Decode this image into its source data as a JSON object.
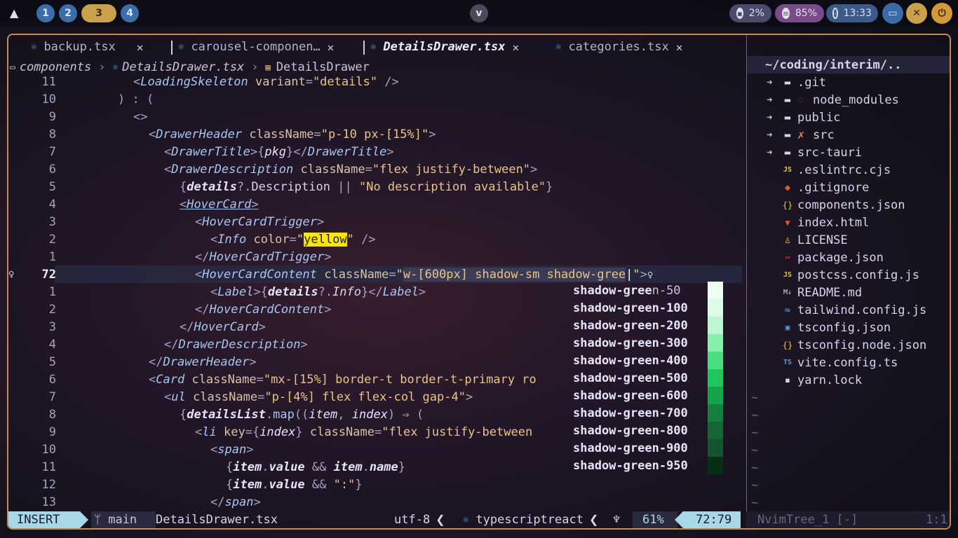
{
  "topbar": {
    "workspaces": [
      "1",
      "2",
      "3",
      "4"
    ],
    "active_workspace": "3",
    "center_label": "v",
    "cpu": "2%",
    "memory": "85%",
    "clock": "13:33"
  },
  "tabs": [
    {
      "name": "backup.tsx",
      "close": "✕"
    },
    {
      "name": "carousel-componen…",
      "close": "✕"
    },
    {
      "name": "DetailsDrawer.tsx",
      "close": "✕",
      "active": true
    },
    {
      "name": "categories.tsx",
      "close": "✕"
    }
  ],
  "breadcrumb": {
    "folder": "components",
    "file": "DetailsDrawer.tsx",
    "symbol": "DetailsDrawer"
  },
  "code": {
    "line_numbers": [
      "11",
      "10",
      "9",
      "8",
      "7",
      "6",
      "5",
      "4",
      "3",
      "2",
      "1",
      "72",
      "1",
      "2",
      "3",
      "4",
      "5",
      "6",
      "7",
      "8",
      "9",
      "10",
      "11",
      "12",
      "13"
    ]
  },
  "completion": {
    "prefix": "shadow-gree",
    "suffixes": [
      "n-50",
      "n-100",
      "n-200",
      "n-300",
      "n-400",
      "n-500",
      "n-600",
      "n-700",
      "n-800",
      "n-900",
      "n-950"
    ],
    "colors": [
      "#f0fdf4",
      "#dcfce7",
      "#bbf7d0",
      "#86efac",
      "#4ade80",
      "#22c55e",
      "#16a34a",
      "#15803d",
      "#166534",
      "#14532d",
      "#052e16"
    ]
  },
  "tree": {
    "root": "~/coding/interim/..",
    "items": [
      {
        "name": ".git",
        "type": "folder"
      },
      {
        "name": "node_modules",
        "type": "folder"
      },
      {
        "name": "public",
        "type": "folder"
      },
      {
        "name": "src",
        "type": "folder"
      },
      {
        "name": "src-tauri",
        "type": "folder"
      },
      {
        "name": ".eslintrc.cjs",
        "type": "file"
      },
      {
        "name": ".gitignore",
        "type": "file"
      },
      {
        "name": "components.json",
        "type": "file"
      },
      {
        "name": "index.html",
        "type": "file"
      },
      {
        "name": "LICENSE",
        "type": "file"
      },
      {
        "name": "package.json",
        "type": "file"
      },
      {
        "name": "postcss.config.js",
        "type": "file"
      },
      {
        "name": "README.md",
        "type": "file"
      },
      {
        "name": "tailwind.config.js",
        "type": "file"
      },
      {
        "name": "tsconfig.json",
        "type": "file"
      },
      {
        "name": "tsconfig.node.json",
        "type": "file"
      },
      {
        "name": "vite.config.ts",
        "type": "file"
      },
      {
        "name": "yarn.lock",
        "type": "file"
      }
    ]
  },
  "status": {
    "mode": "INSERT",
    "branch": "main",
    "file": "DetailsDrawer.tsx",
    "encoding": "utf-8",
    "filetype": "typescriptreact",
    "percent": "61%",
    "position": "72:79",
    "tree_name": "NvimTree_1 [-]",
    "tree_pos": "1:1"
  }
}
